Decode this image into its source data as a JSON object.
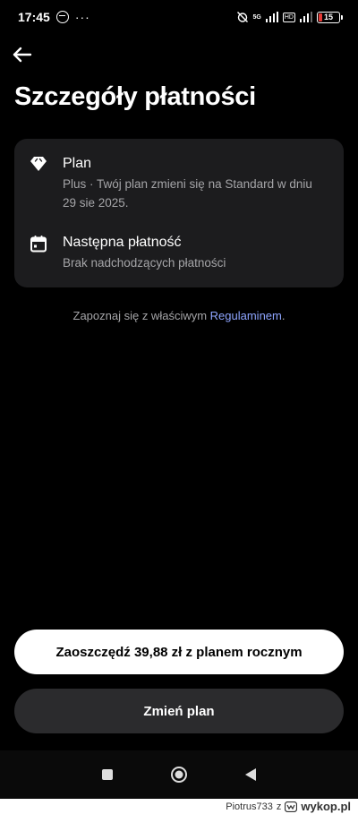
{
  "status_bar": {
    "time": "17:45",
    "more": "···",
    "network": "5G",
    "tag1": "HD",
    "tag2": "HD",
    "battery": "15"
  },
  "page": {
    "title": "Szczegóły płatności"
  },
  "details": {
    "plan": {
      "icon": "diamond-icon",
      "title": "Plan",
      "subtitle": "Plus · Twój plan zmieni się na Standard w dniu 29 sie 2025."
    },
    "next_payment": {
      "icon": "calendar-icon",
      "title": "Następna płatność",
      "subtitle": "Brak nadchodzących płatności"
    }
  },
  "terms": {
    "prefix": "Zapoznaj się z właściwym ",
    "link": "Regulaminem",
    "suffix": "."
  },
  "buttons": {
    "save_annual": "Zaoszczędź 39,88 zł z planem rocznym",
    "change_plan": "Zmień plan"
  },
  "watermark": {
    "user": "Piotrus733",
    "separator": "z",
    "site": "wykop.pl"
  },
  "colors": {
    "background": "#000000",
    "card": "#1c1c1e",
    "link": "#8ea5ff",
    "secondary_button": "#2b2b2d"
  }
}
